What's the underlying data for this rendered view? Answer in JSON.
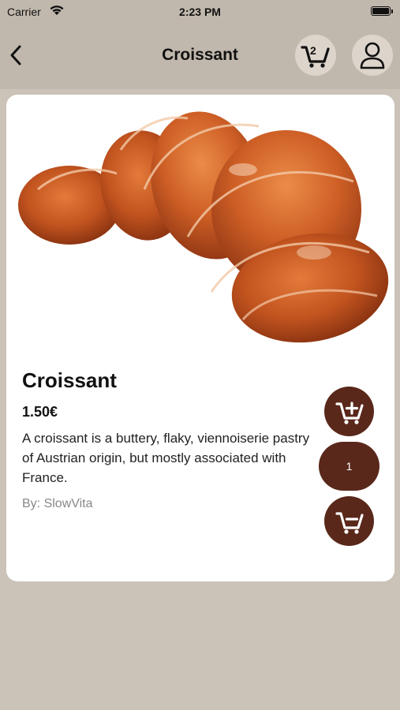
{
  "status_bar": {
    "carrier": "Carrier",
    "time": "2:23 PM"
  },
  "nav": {
    "title": "Croissant",
    "cart_count": "2"
  },
  "product": {
    "name": "Croissant",
    "price": "1.50€",
    "description": "A croissant is a buttery, flaky, viennoiserie pastry of Austrian origin, but mostly associated with France.",
    "author": "By: SlowVita",
    "quantity": "1"
  },
  "colors": {
    "header_bg": "#c1b8ad",
    "page_bg": "#cbc3b8",
    "accent": "#59281a",
    "round_button_bg": "#ddd5cc"
  },
  "icons": {
    "back": "chevron-left-icon",
    "cart": "cart-icon",
    "user": "user-icon",
    "add_to_cart": "cart-plus-icon",
    "remove_from_cart": "cart-minus-icon"
  }
}
